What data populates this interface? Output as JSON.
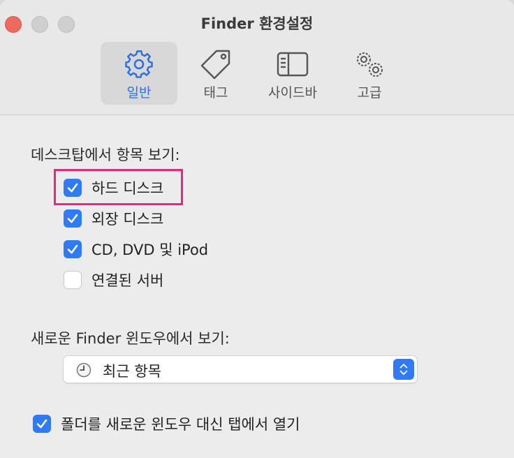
{
  "window": {
    "title": "Finder 환경설정"
  },
  "toolbar": {
    "tabs": [
      {
        "label": "일반",
        "icon": "gear-icon",
        "active": true
      },
      {
        "label": "태그",
        "icon": "tag-icon",
        "active": false
      },
      {
        "label": "사이드바",
        "icon": "sidebar-icon",
        "active": false
      },
      {
        "label": "고급",
        "icon": "gears-icon",
        "active": false
      }
    ]
  },
  "desktop_section": {
    "heading": "데스크탑에서 항목 보기:",
    "items": [
      {
        "label": "하드 디스크",
        "checked": true
      },
      {
        "label": "외장 디스크",
        "checked": true
      },
      {
        "label": "CD, DVD 및 iPod",
        "checked": true
      },
      {
        "label": "연결된 서버",
        "checked": false
      }
    ]
  },
  "new_window_section": {
    "heading": "새로운 Finder 윈도우에서 보기:",
    "selected": "최근 항목",
    "icon": "clock-icon"
  },
  "tabs_option": {
    "label": "폴더를 새로운 윈도우 대신 탭에서 열기",
    "checked": true
  },
  "colors": {
    "accent": "#2f7bf6",
    "highlight": "#e6287a",
    "close": "#ec6a5e"
  }
}
